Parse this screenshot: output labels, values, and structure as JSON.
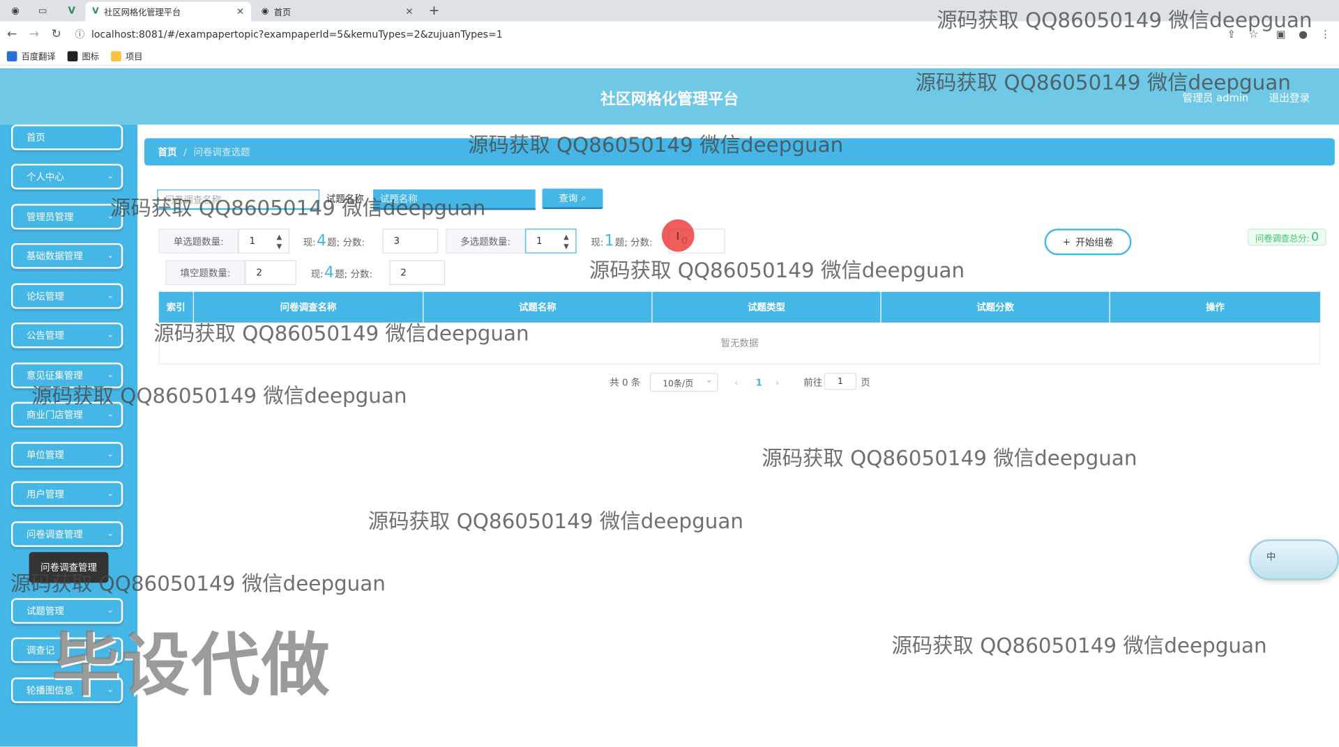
{
  "browser": {
    "tabs": [
      {
        "title": "社区网格化管理平台",
        "active": true
      },
      {
        "title": "首页",
        "active": false
      }
    ],
    "url": "localhost:8081/#/exampapertopic?exampaperId=5&kemuTypes=2&zujuanTypes=1",
    "bookmarks": [
      {
        "label": "百度翻译",
        "color": "#2a6fd6"
      },
      {
        "label": "图标",
        "color": "#222222"
      },
      {
        "label": "项目",
        "color": "#f6c342"
      }
    ]
  },
  "header": {
    "title": "社区网格化管理平台",
    "user": "管理员 admin",
    "logout": "退出登录"
  },
  "sidebar": {
    "items": [
      {
        "label": "首页",
        "expandable": false
      },
      {
        "label": "个人中心",
        "expandable": true
      },
      {
        "label": "管理员管理",
        "expandable": true
      },
      {
        "label": "基础数据管理",
        "expandable": true
      },
      {
        "label": "论坛管理",
        "expandable": true
      },
      {
        "label": "公告管理",
        "expandable": true
      },
      {
        "label": "意见征集管理",
        "expandable": true
      },
      {
        "label": "商业门店管理",
        "expandable": true
      },
      {
        "label": "单位管理",
        "expandable": true
      },
      {
        "label": "用户管理",
        "expandable": true
      },
      {
        "label": "问卷调查管理",
        "expandable": true
      },
      {
        "label": "试题管理",
        "expandable": true
      },
      {
        "label": "调查记",
        "expandable": true
      },
      {
        "label": "轮播图信息",
        "expandable": true
      }
    ],
    "tooltip": "问卷调查管理"
  },
  "breadcrumb": {
    "home": "首页",
    "separator": "/",
    "current": "问卷调查选题"
  },
  "search": {
    "field1_placeholder": "问卷调查名称",
    "field2_label": "试题名称",
    "field2_placeholder": "试题名称",
    "query_label": "查询"
  },
  "counters": {
    "single": {
      "label": "单选题数量:",
      "value": "1",
      "now_prefix": "现:",
      "now_count": "4",
      "now_suffix": "题; 分数:",
      "score": "3"
    },
    "multi": {
      "label": "多选题数量:",
      "value": "1",
      "now_prefix": "现:",
      "now_count": "1",
      "now_suffix": "题; 分数:",
      "score": "0"
    },
    "fill": {
      "label": "填空题数量:",
      "value": "2",
      "now_prefix": "现:",
      "now_count": "4",
      "now_suffix": "题; 分数:",
      "score": "2"
    }
  },
  "start_button": "开始组卷",
  "total_score": {
    "label": "问卷调查总分:",
    "value": "0"
  },
  "table": {
    "columns": [
      "索引",
      "问卷调查名称",
      "试题名称",
      "试题类型",
      "试题分数",
      "操作"
    ],
    "empty_text": "暂无数据"
  },
  "pagination": {
    "total": "共 0 条",
    "page_size": "10条/页",
    "prev": "‹",
    "current_page": "1",
    "next": "›",
    "goto_label": "前往",
    "goto_value": "1",
    "page_suffix": "页"
  },
  "ime": {
    "label": "中"
  },
  "watermark": {
    "text": "源码获取 QQ86050149 微信deepguan",
    "big": "毕设代做"
  },
  "colors": {
    "primary": "#45b7e6",
    "header": "#6ec8e6",
    "accent_green": "#2fbf63"
  }
}
